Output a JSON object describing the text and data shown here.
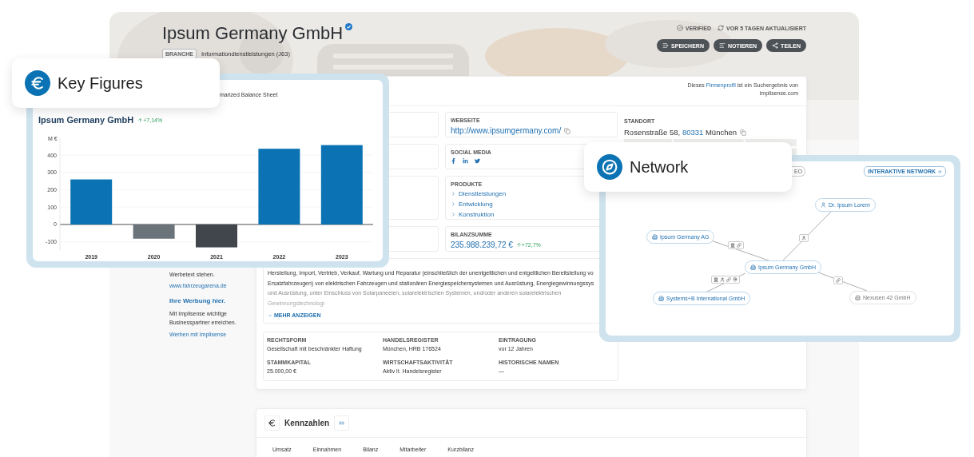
{
  "header": {
    "title": "Ipsum Germany GmbH",
    "industry_tag": "BRANCHE",
    "industry": "Informationdienstleistungen (J63)",
    "status": [
      {
        "kind": "verified",
        "label": "VERIFIED"
      },
      {
        "kind": "updated",
        "label": "VOR 5 TAGEN AKTUALISIERT"
      }
    ],
    "actions": [
      {
        "kind": "save",
        "label": "SPEICHERN"
      },
      {
        "kind": "note",
        "label": "NOTIEREN"
      },
      {
        "kind": "share",
        "label": "TEILEN"
      }
    ]
  },
  "sidebar_ad": [
    {
      "kind": "text",
      "text": "Werbetext stehen."
    },
    {
      "kind": "link",
      "text": "www.fahrzeugarena.de"
    },
    {
      "kind": "heading",
      "text": "Ihre Werbung hier."
    },
    {
      "kind": "text",
      "text": "Mit Implisense wichtige Businesspartner erreichen."
    },
    {
      "kind": "link",
      "text": "Werben mit Implisense"
    }
  ],
  "source_note": {
    "before": "Dieses",
    "link": "Firmenprofil",
    "after": "ist ein Suchergebnis von implisense.com"
  },
  "website": {
    "label": "WEBSEITE",
    "value": "http://www.ipsumgermany.com/"
  },
  "social_media": {
    "label": "SOCIAL MEDIA",
    "networks": [
      {
        "kind": "facebook"
      },
      {
        "kind": "linkedin"
      },
      {
        "kind": "twitter"
      }
    ]
  },
  "products": {
    "label": "PRODUKTE",
    "items": [
      "Dienstleistungen",
      "Entwicklung",
      "Konstruktion"
    ]
  },
  "balance_total": {
    "label": "BILANZSUMME",
    "value": "235.988.239,72 €",
    "change": "+72,7%"
  },
  "location": {
    "label": "STANDORT",
    "street": "Rosenstraße 58,",
    "postcode": "80331",
    "city": "München"
  },
  "description": {
    "lines": [
      "Herstellung, Import, Vertrieb, Verkauf, Wartung und Reparatur (einschließlich der unentgeltlichen und entgeltlichen Bereitstellung vo",
      "Ersatzfahrzeugen) von elektrischen Fahrzeugen und stationären Energiespeichersystemen und Ausrüstung, Energiegewinnungssys"
    ],
    "faded_lines": [
      "und Ausrüstung, unter Einschluss von Solarpaneelen, solarelektrischen Systemen, und/oder anderen solarelektrischen",
      "Gewinnungstechnologi"
    ],
    "more": "MEHR ANZEIGEN"
  },
  "details": [
    {
      "label": "RECHTSFORM",
      "value": "Gesellschaft mit beschränkter Haftung"
    },
    {
      "label": "HANDELSREGISTER",
      "value": "München, HRB 176524"
    },
    {
      "label": "EINTRAGUNG",
      "value": "vor 12 Jahren"
    },
    {
      "label": "STAMMKAPITAL",
      "value": "25.000,00 €"
    },
    {
      "label": "WIRTSCHAFTSAKTIVITÄT",
      "value": "Aktiv lt. Handelsregister"
    },
    {
      "label": "HISTORISCHE NAMEN",
      "value": "—"
    }
  ],
  "key_figures_section": {
    "title": "Kennzahlen",
    "tabs": [
      "Umsatz",
      "Einnahmen",
      "Bilanz",
      "Mitarbeiter",
      "Kurzbilanz"
    ]
  },
  "key_figures_callout": {
    "label": "Key Figures"
  },
  "chart_panel": {
    "caption": "marized Balance Sheet",
    "change": "+7,14%",
    "chart_data": {
      "type": "bar",
      "title": "Ipsum Germany GmbH",
      "ylabel": "M €",
      "categories": [
        "2019",
        "2020",
        "2021",
        "2022",
        "2023"
      ],
      "series": [
        {
          "color": "#0b73b3",
          "colors": [
            null,
            "#6b737b",
            "#40464c",
            null,
            null
          ],
          "values": [
            260,
            -82,
            -132,
            437,
            458
          ]
        }
      ],
      "yticks": [
        -100,
        0,
        100,
        200,
        300,
        400
      ],
      "ylim": [
        -150,
        500
      ],
      "grid": true
    }
  },
  "network_callout": {
    "label": "Network"
  },
  "network_panel": {
    "partial_button": "EO",
    "link": "INTERAKTIVE NETWORK",
    "nodes": [
      {
        "label": "Ipsum Germany GmbH",
        "kind": "company",
        "active": true
      },
      {
        "label": "Dr. Ipsum Lorem",
        "kind": "person",
        "active": true
      },
      {
        "label": "Ipsum Germany AG",
        "kind": "company",
        "active": true
      },
      {
        "label": "Systems+B International GmbH",
        "kind": "company",
        "active": true
      },
      {
        "label": "Nexusen 42 GmbH",
        "kind": "company",
        "active": false
      }
    ]
  }
}
